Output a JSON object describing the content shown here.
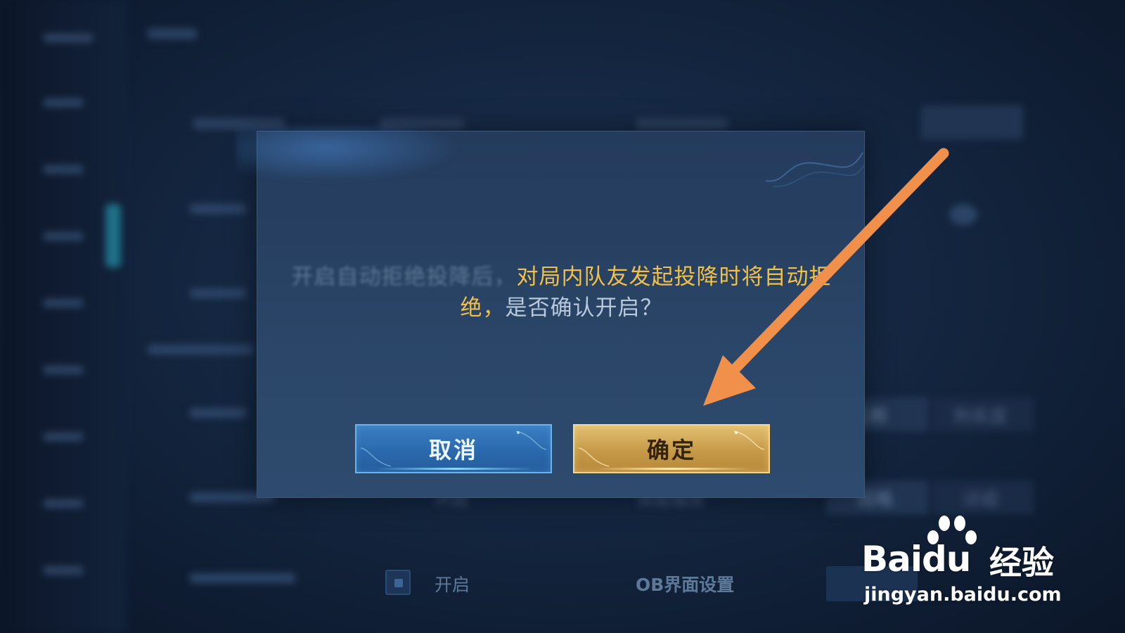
{
  "dialog": {
    "message_faded": "开启自动拒绝投降后，",
    "message_highlight": "对局内队友发起投降时将自动拒绝，",
    "message_tail": "是否确认开启？",
    "cancel_label": "取消",
    "confirm_label": "确定"
  },
  "background": {
    "name_header": "名称",
    "proficiency_header": "熟练度",
    "brief_option": "简略",
    "detail_option": "详细",
    "open_label_faded": "开启",
    "skill_desc_label": "技能描述",
    "open_label": "开启",
    "ob_settings_label": "OB界面设置"
  },
  "watermark": {
    "brand": "Baidu",
    "product": "经验",
    "url": "jingyan.baidu.com"
  },
  "colors": {
    "highlight_gold": "#f2c048",
    "cancel_blue": "#2b69ad",
    "confirm_gold": "#c69a48",
    "arrow_orange": "#f0904a"
  }
}
